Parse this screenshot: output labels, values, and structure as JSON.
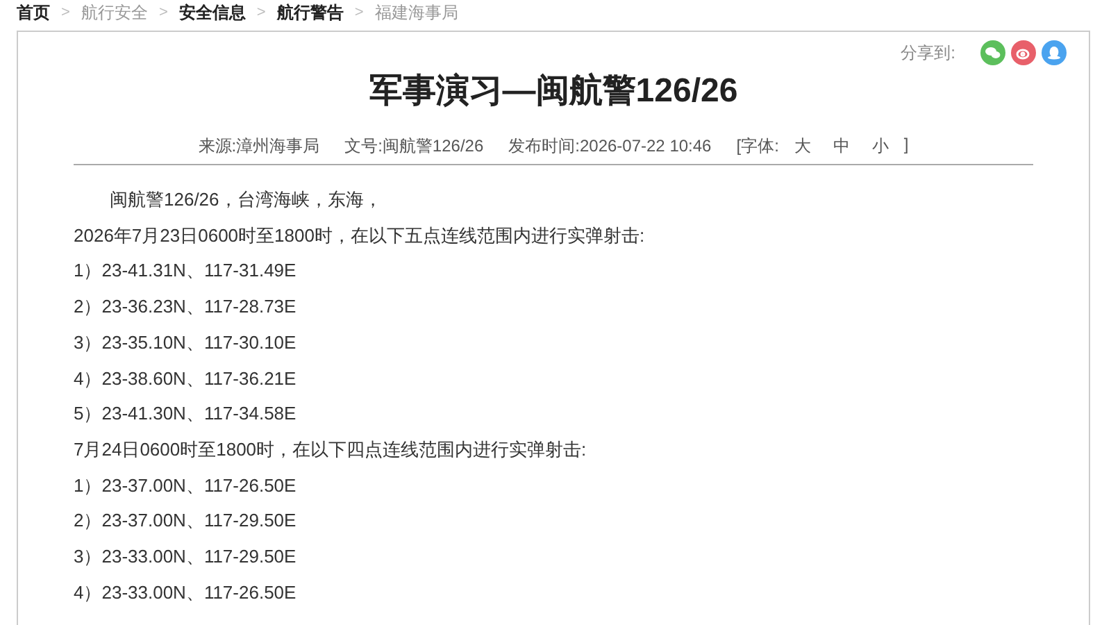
{
  "breadcrumb": {
    "separator": ">",
    "items": [
      {
        "label": "首页",
        "bold": true
      },
      {
        "label": "航行安全",
        "bold": false
      },
      {
        "label": "安全信息",
        "bold": true
      },
      {
        "label": "航行警告",
        "bold": true
      },
      {
        "label": "福建海事局",
        "bold": false
      }
    ]
  },
  "share": {
    "label": "分享到:",
    "targets": [
      {
        "kind": "wechat",
        "color": "#5cbf5c"
      },
      {
        "kind": "weibo",
        "color": "#e8606a"
      },
      {
        "kind": "qq",
        "color": "#4aa3ef"
      }
    ]
  },
  "article": {
    "title": "军事演习—闽航警126/26",
    "meta": [
      {
        "label": "来源:",
        "value": "漳州海事局"
      },
      {
        "label": "文号:",
        "value": "闽航警126/26"
      },
      {
        "label": "发布时间:",
        "value": "2026-07-22 10:46"
      }
    ],
    "font_size": {
      "label": "[字体:",
      "options": [
        "大",
        "中",
        "小"
      ],
      "end": "]"
    },
    "paragraphs": [
      {
        "kind": "indented",
        "text": "闽航警126/26，台湾海峡，东海，"
      },
      {
        "kind": "plain",
        "text": "2026年7月23日0600时至1800时，在以下五点连线范围内进行实弹射击:"
      },
      {
        "kind": "plain",
        "text": "1）23-41.31N、117-31.49E"
      },
      {
        "kind": "plain",
        "text": "2）23-36.23N、117-28.73E"
      },
      {
        "kind": "plain",
        "text": "3）23-35.10N、117-30.10E"
      },
      {
        "kind": "plain",
        "text": "4）23-38.60N、117-36.21E"
      },
      {
        "kind": "plain",
        "text": "5）23-41.30N、117-34.58E"
      },
      {
        "kind": "plain",
        "text": "7月24日0600时至1800时，在以下四点连线范围内进行实弹射击:"
      },
      {
        "kind": "plain",
        "text": "1）23-37.00N、117-26.50E"
      },
      {
        "kind": "plain",
        "text": "2）23-37.00N、117-29.50E"
      },
      {
        "kind": "plain",
        "text": "3）23-33.00N、117-29.50E"
      },
      {
        "kind": "plain",
        "text": "4）23-33.00N、117-26.50E"
      }
    ]
  }
}
